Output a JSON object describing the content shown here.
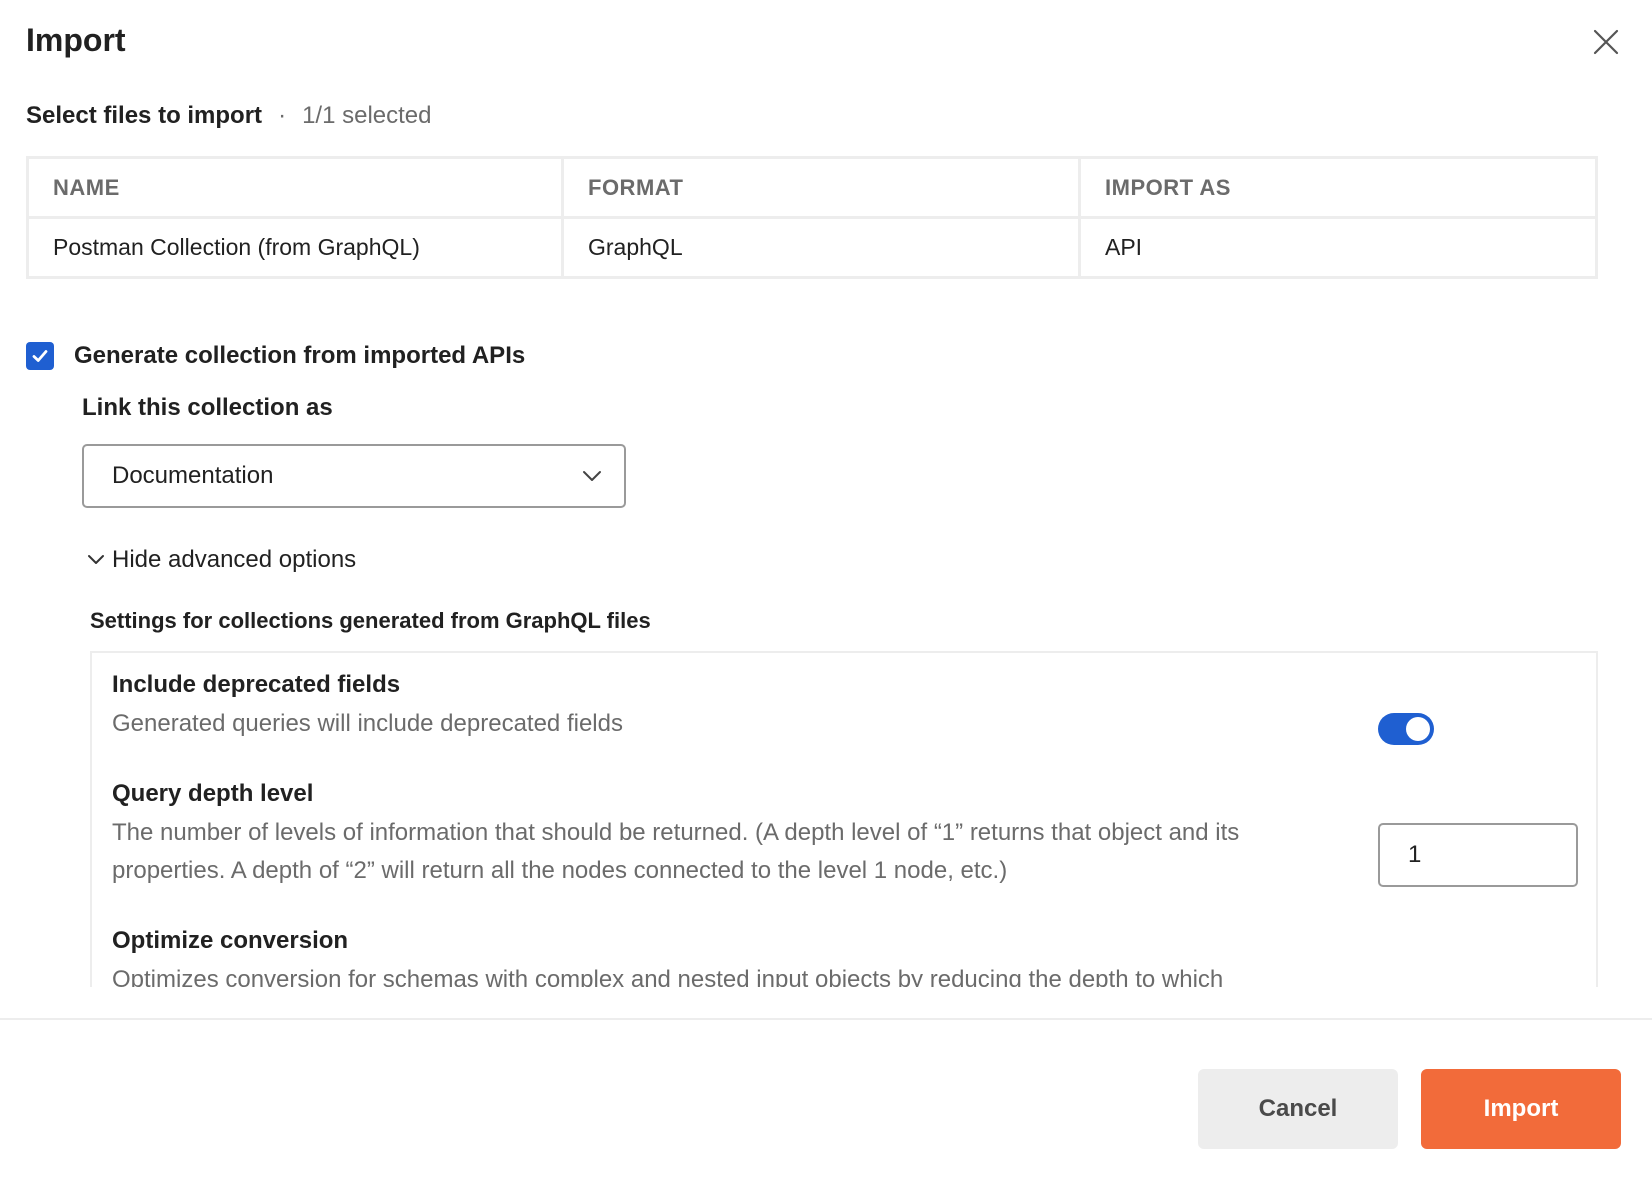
{
  "dialog": {
    "title": "Import"
  },
  "selection": {
    "label": "Select files to import",
    "separator": "·",
    "count": "1/1 selected"
  },
  "table": {
    "headers": [
      "NAME",
      "FORMAT",
      "IMPORT AS"
    ],
    "rows": [
      [
        "Postman Collection (from GraphQL)",
        "GraphQL",
        "API"
      ]
    ]
  },
  "generate": {
    "label": "Generate collection from imported APIs",
    "checked": true
  },
  "link": {
    "label": "Link this collection as",
    "selected": "Documentation"
  },
  "advanced": {
    "toggle_label": "Hide advanced options",
    "section_title": "Settings for collections generated from GraphQL files",
    "settings": [
      {
        "title": "Include deprecated fields",
        "description": "Generated queries will include deprecated fields",
        "enabled": true
      },
      {
        "title": "Query depth level",
        "description": "The number of levels of information that should be returned. (A depth level of “1” returns that object and its properties. A depth of “2” will return all the nodes connected to the level 1 node, etc.)",
        "value": "1"
      },
      {
        "title": "Optimize conversion",
        "description": "Optimizes conversion for schemas with complex and nested input objects by reducing the depth to which"
      }
    ]
  },
  "footer": {
    "cancel_label": "Cancel",
    "import_label": "Import"
  },
  "colors": {
    "accent": "#1f5fd1",
    "primary_button": "#f26b3a"
  }
}
